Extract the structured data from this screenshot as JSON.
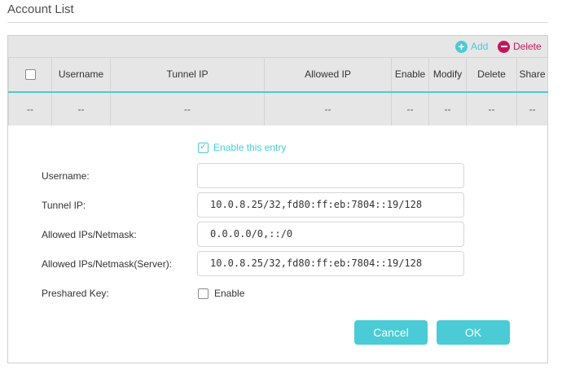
{
  "section": {
    "title": "Account List"
  },
  "toolbar": {
    "add_label": "Add",
    "delete_label": "Delete"
  },
  "table": {
    "columns": [
      "Username",
      "Tunnel IP",
      "Allowed IP",
      "Enable",
      "Modify",
      "Delete",
      "Share"
    ],
    "row": [
      "--",
      "--",
      "--",
      "--",
      "--",
      "--",
      "--",
      "--"
    ]
  },
  "form": {
    "enable_entry_label": "Enable this entry",
    "username_label": "Username:",
    "username_value": "",
    "tunnel_ip_label": "Tunnel IP:",
    "tunnel_ip_value": "10.0.8.25/32,fd80:ff:eb:7804::19/128",
    "allowed_ips_label": "Allowed IPs/Netmask:",
    "allowed_ips_value": "0.0.0.0/0,::/0",
    "allowed_ips_server_label": "Allowed IPs/Netmask(Server):",
    "allowed_ips_server_value": "10.0.8.25/32,fd80:ff:eb:7804::19/128",
    "preshared_key_label": "Preshared Key:",
    "preshared_enable_label": "Enable",
    "cancel_label": "Cancel",
    "ok_label": "OK"
  },
  "colors": {
    "accent": "#4acbd6",
    "delete": "#c2185b"
  },
  "icons": {
    "add": "plus-circle-icon",
    "delete": "minus-circle-icon",
    "check": "checkmark-icon"
  }
}
